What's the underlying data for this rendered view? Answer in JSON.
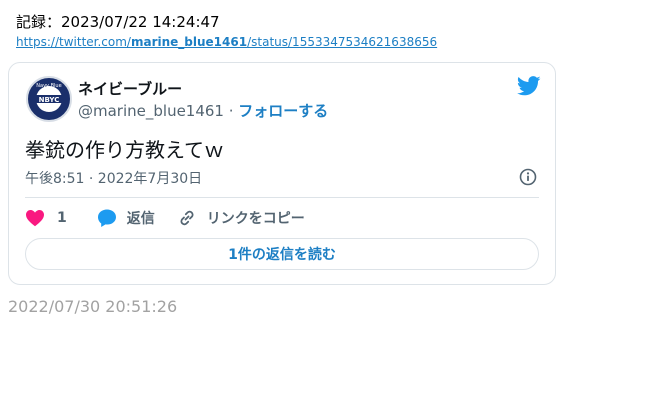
{
  "record": "記録：2023/07/22 14:24:47",
  "link": {
    "prefix": "https://twitter.com/",
    "user": "marine_blue1461",
    "suffix": "/status/1553347534621638656"
  },
  "tweet": {
    "display_name": "ネイビーブルー",
    "handle": "@marine_blue1461",
    "separator": " · ",
    "follow_label": "フォローする",
    "text": "拳銃の作り方教えてｗ",
    "timestamp": "午後8:51 · 2022年7月30日",
    "like_count": "1",
    "reply_label": "返信",
    "copy_link_label": "リンクをコピー",
    "read_replies_label": "1件の返信を読む",
    "avatar_text": "NBYC",
    "avatar_ring_text": "Navy Blue"
  },
  "footer_date": "2022/07/30 20:51:26",
  "colors": {
    "brand_blue": "#1d9bf0",
    "like_pink": "#f91880",
    "text_gray": "#536471",
    "link_blue": "#1d7fc4"
  },
  "icons": [
    "twitter-bird-icon",
    "info-icon",
    "heart-icon",
    "reply-bubble-icon",
    "link-icon"
  ]
}
